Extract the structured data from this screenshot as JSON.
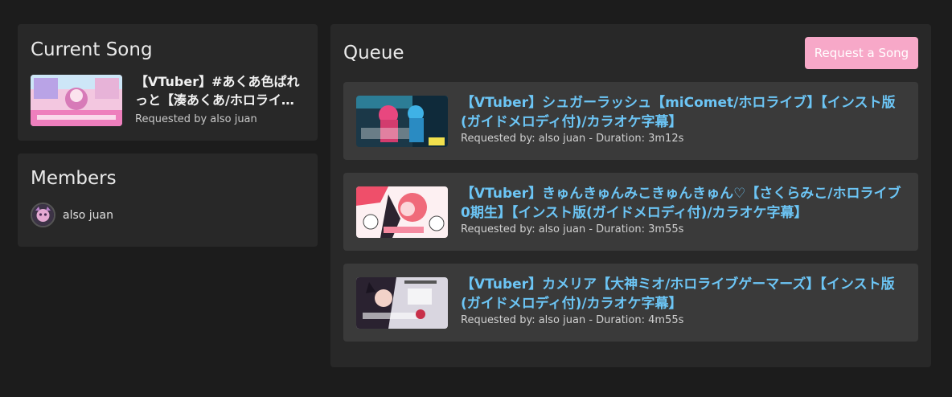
{
  "current_song": {
    "heading": "Current Song",
    "title": "【VTuber】#あくあ色ぱれっと【湊あくあ/ホロライブ】【インスト版(ガイドメロディ付)/カラオケ字幕】",
    "requested_by": "Requested by also juan"
  },
  "members": {
    "heading": "Members",
    "list": [
      {
        "name": "also juan"
      }
    ]
  },
  "queue": {
    "heading": "Queue",
    "request_button": "Request a Song",
    "items": [
      {
        "title": "【VTuber】シュガーラッシュ【miComet/ホロライブ】【インスト版(ガイドメロディ付)/カラオケ字幕】",
        "meta": "Requested by: also juan - Duration: 3m12s"
      },
      {
        "title": "【VTuber】きゅんきゅんみこきゅんきゅん♡【さくらみこ/ホロライブ0期生】【インスト版(ガイドメロディ付)/カラオケ字幕】",
        "meta": "Requested by: also juan - Duration: 3m55s"
      },
      {
        "title": "【VTuber】カメリア【大神ミオ/ホロライブゲーマーズ】【インスト版(ガイドメロディ付)/カラオケ字幕】",
        "meta": "Requested by: also juan - Duration: 4m55s"
      }
    ]
  },
  "colors": {
    "background": "#1c1c1c",
    "panel": "#282828",
    "queue_item": "#3a3a3a",
    "accent_button": "#f7a8c8",
    "link_title": "#6cc5f5"
  }
}
